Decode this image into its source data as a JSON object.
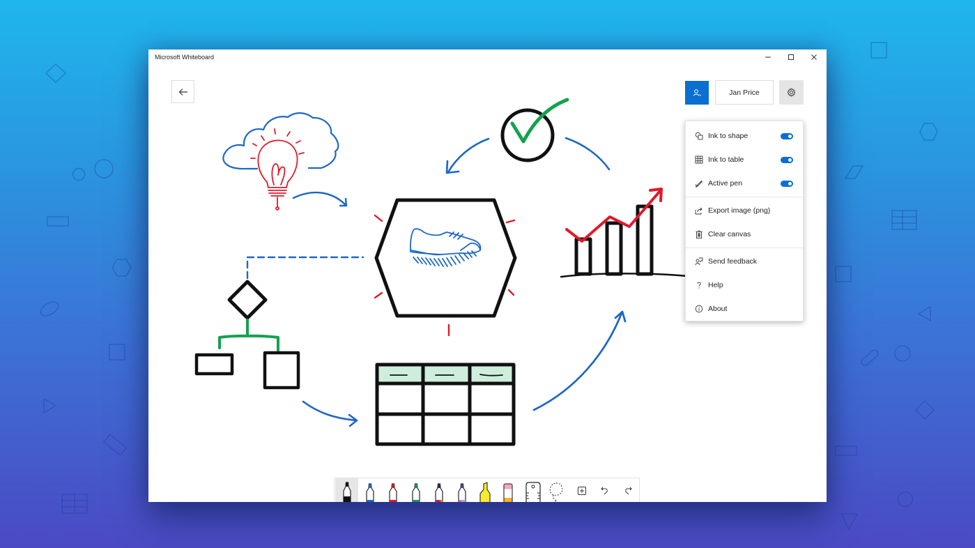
{
  "window": {
    "title": "Microsoft Whiteboard",
    "controls": [
      "minimize",
      "maximize",
      "close"
    ]
  },
  "header": {
    "back_icon": "arrow-left-icon",
    "share_icon": "invite-person-icon",
    "user_name": "Jan Price",
    "settings_icon": "gear-icon"
  },
  "settings_menu": {
    "items": [
      {
        "label": "Ink to shape",
        "icon": "ink-to-shape-icon",
        "toggle": true
      },
      {
        "label": "Ink to table",
        "icon": "table-grid-icon",
        "toggle": true
      },
      {
        "label": "Active pen",
        "icon": "pen-icon",
        "toggle": true
      },
      {
        "label": "Export image (png)",
        "icon": "share-export-icon"
      },
      {
        "label": "Clear canvas",
        "icon": "trash-icon"
      },
      {
        "label": "Send feedback",
        "icon": "feedback-icon"
      },
      {
        "label": "Help",
        "icon": "question-icon"
      },
      {
        "label": "About",
        "icon": "info-icon"
      }
    ]
  },
  "toolbar": {
    "tools": [
      {
        "name": "black-pen",
        "color": "#111111",
        "active": true
      },
      {
        "name": "blue-pen",
        "color": "#1c68c4"
      },
      {
        "name": "red-pen",
        "color": "#e0192b"
      },
      {
        "name": "green-pen",
        "color": "#13955a"
      },
      {
        "name": "rainbow-pen",
        "color": "#5b3fb0"
      },
      {
        "name": "galaxy-pen",
        "color": "#8a6ac8"
      },
      {
        "name": "highlighter",
        "color": "#f7ec2c"
      },
      {
        "name": "eraser",
        "color": "#f2a7c7"
      },
      {
        "name": "ruler"
      },
      {
        "name": "lasso-select"
      },
      {
        "name": "add"
      },
      {
        "name": "undo"
      },
      {
        "name": "redo"
      }
    ]
  },
  "colors": {
    "accent": "#0a6fd1",
    "ink_blue": "#1c68c4",
    "ink_red": "#e0192b",
    "ink_green": "#13a24f",
    "table_header_fill": "#cdeedb"
  }
}
